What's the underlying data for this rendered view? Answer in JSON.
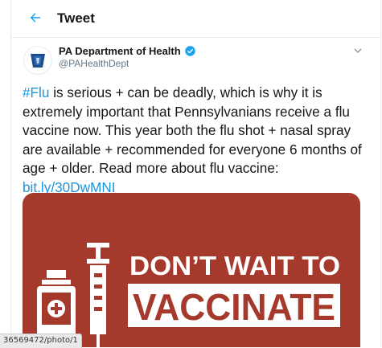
{
  "header": {
    "title": "Tweet"
  },
  "author": {
    "name": "PA Department of Health",
    "handle": "@PAHealthDept"
  },
  "tweet": {
    "hashtag": "#Flu",
    "line1_rest": " is serious + can be deadly, which is why it is",
    "line2": "extremely important that Pennsylvanians receive a flu",
    "line3": "vaccine now. This year both the flu shot + nasal spray",
    "line4": "are available + recommended for everyone 6 months of",
    "line5": "age + older. Read more about flu vaccine:",
    "link": "bit.ly/30DwMNI"
  },
  "media": {
    "line1": "DON’T WAIT TO",
    "line2": "VACCINATE"
  },
  "status_bar": {
    "url": "36569472/photo/1"
  },
  "colors": {
    "accent": "#1da1f2",
    "link": "#1b95e0",
    "banner": "#a53a2c",
    "text": "#14171a",
    "secondary": "#657786"
  }
}
